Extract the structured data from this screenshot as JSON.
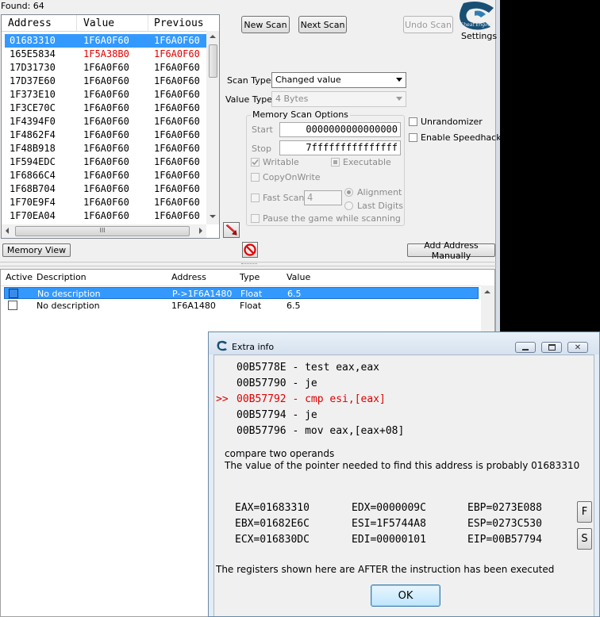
{
  "main": {
    "found_label": "Found: 64",
    "columns": [
      "Address",
      "Value",
      "Previous"
    ],
    "rows": [
      {
        "address": "01683310",
        "value": "1F6A0F60",
        "previous": "1F6A0F60",
        "selected": true,
        "changed": false
      },
      {
        "address": "165E5834",
        "value": "1F5A38B0",
        "previous": "1F6A0F60",
        "selected": false,
        "changed": true
      },
      {
        "address": "17D31730",
        "value": "1F6A0F60",
        "previous": "1F6A0F60",
        "selected": false,
        "changed": false
      },
      {
        "address": "17D37E60",
        "value": "1F6A0F60",
        "previous": "1F6A0F60",
        "selected": false,
        "changed": false
      },
      {
        "address": "1F373E10",
        "value": "1F6A0F60",
        "previous": "1F6A0F60",
        "selected": false,
        "changed": false
      },
      {
        "address": "1F3CE70C",
        "value": "1F6A0F60",
        "previous": "1F6A0F60",
        "selected": false,
        "changed": false
      },
      {
        "address": "1F4394F0",
        "value": "1F6A0F60",
        "previous": "1F6A0F60",
        "selected": false,
        "changed": false
      },
      {
        "address": "1F4862F4",
        "value": "1F6A0F60",
        "previous": "1F6A0F60",
        "selected": false,
        "changed": false
      },
      {
        "address": "1F48B918",
        "value": "1F6A0F60",
        "previous": "1F6A0F60",
        "selected": false,
        "changed": false
      },
      {
        "address": "1F594EDC",
        "value": "1F6A0F60",
        "previous": "1F6A0F60",
        "selected": false,
        "changed": false
      },
      {
        "address": "1F6866C4",
        "value": "1F6A0F60",
        "previous": "1F6A0F60",
        "selected": false,
        "changed": false
      },
      {
        "address": "1F68B704",
        "value": "1F6A0F60",
        "previous": "1F6A0F60",
        "selected": false,
        "changed": false
      },
      {
        "address": "1F70E9F4",
        "value": "1F6A0F60",
        "previous": "1F6A0F60",
        "selected": false,
        "changed": false
      },
      {
        "address": "1F70EA04",
        "value": "1F6A0F60",
        "previous": "1F6A0F60",
        "selected": false,
        "changed": false
      }
    ],
    "hscroll_grip": "III",
    "buttons": {
      "new_scan": "New Scan",
      "next_scan": "Next Scan",
      "undo_scan": "Undo Scan",
      "memory_view": "Memory View",
      "add_address": "Add Address Manually"
    },
    "settings_label": "Settings",
    "logo_text": "Cheat Engine",
    "scan_type": {
      "label": "Scan Type",
      "value": "Changed value"
    },
    "value_type": {
      "label": "Value Type",
      "value": "4 Bytes"
    },
    "memory_options": {
      "title": "Memory Scan Options",
      "start_label": "Start",
      "start_value": "0000000000000000",
      "stop_label": "Stop",
      "stop_value": "7fffffffffffffff",
      "writable": "Writable",
      "executable": "Executable",
      "copyonwrite": "CopyOnWrite",
      "fast_scan": "Fast Scan",
      "fast_scan_value": "4",
      "alignment": "Alignment",
      "last_digits": "Last Digits",
      "pause": "Pause the game while scanning"
    },
    "unrandomizer": "Unrandomizer",
    "speedhack": "Enable Speedhack",
    "address_list": {
      "columns": [
        "Active",
        "Description",
        "Address",
        "Type",
        "Value"
      ],
      "rows": [
        {
          "description": "No description",
          "address": "P->1F6A1480",
          "type": "Float",
          "value": "6.5",
          "selected": true
        },
        {
          "description": "No description",
          "address": "1F6A1480",
          "type": "Float",
          "value": "6.5",
          "selected": false
        }
      ]
    }
  },
  "dialog": {
    "title": "Extra info",
    "asm_marker": ">>",
    "asm": [
      {
        "text": "00B5778E - test eax,eax",
        "highlight": false
      },
      {
        "text": "00B57790 - je",
        "highlight": false
      },
      {
        "text": "00B57792 - cmp esi,[eax]",
        "highlight": true
      },
      {
        "text": "00B57794 - je",
        "highlight": false
      },
      {
        "text": "00B57796 - mov eax,[eax+08]",
        "highlight": false
      }
    ],
    "description": "compare two operands",
    "pointer_text": "The value of the pointer needed to find this address is probably 01683310",
    "registers": [
      [
        "EAX=01683310",
        "EDX=0000009C",
        "EBP=0273E088"
      ],
      [
        "EBX=01682E6C",
        "ESI=1F5744A8",
        "ESP=0273C530"
      ],
      [
        "ECX=016830DC",
        "EDI=00000101",
        "EIP=00B57794"
      ]
    ],
    "f_button": "F",
    "s_button": "S",
    "footer": "The registers shown here are AFTER the instruction has been executed",
    "ok": "OK",
    "colors": {
      "highlight": "#e00000",
      "accent": "#3399ff"
    }
  }
}
